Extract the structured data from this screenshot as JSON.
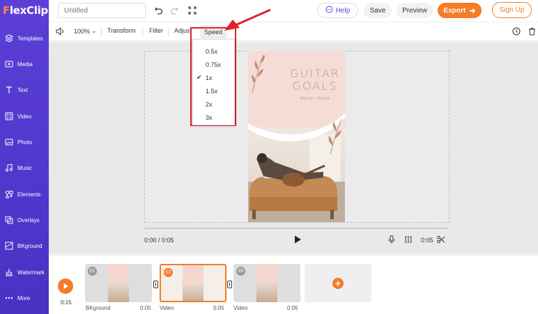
{
  "app": {
    "logo_text": "lexClip",
    "logo_letter": "F"
  },
  "sidebar": {
    "items": [
      {
        "label": "Templates",
        "icon": "templates-icon"
      },
      {
        "label": "Media",
        "icon": "media-icon"
      },
      {
        "label": "Text",
        "icon": "text-icon"
      },
      {
        "label": "Video",
        "icon": "video-icon"
      },
      {
        "label": "Photo",
        "icon": "photo-icon"
      },
      {
        "label": "Music",
        "icon": "music-icon"
      },
      {
        "label": "Elements",
        "icon": "elements-icon"
      },
      {
        "label": "Overlays",
        "icon": "overlays-icon"
      },
      {
        "label": "BKground",
        "icon": "background-icon"
      },
      {
        "label": "Watermark",
        "icon": "watermark-icon"
      },
      {
        "label": "More",
        "icon": "more-icon"
      }
    ]
  },
  "topbar": {
    "title_placeholder": "Untitled",
    "help_label": "Help",
    "save_label": "Save",
    "preview_label": "Preview",
    "export_label": "Export",
    "signup_label": "Sign Up"
  },
  "toolbar": {
    "zoom": "100%",
    "transform_label": "Transform",
    "filter_label": "Filter",
    "adjust_label": "Adjus",
    "speed_label": "Speed"
  },
  "speed_menu": {
    "options": [
      "0.5x",
      "0.75x",
      "1x",
      "1.5x",
      "2x",
      "3x"
    ],
    "selected": "1x"
  },
  "poster": {
    "title_line1": "GUITAR",
    "title_line2": "GOALS",
    "subtitle": "DELHI, INDIA"
  },
  "playback": {
    "current_time": "0:00 / 0:05",
    "duration": "0:05"
  },
  "timeline": {
    "total_time": "0:15",
    "clips": [
      {
        "num": "01",
        "label": "BKground",
        "duration": "0:05"
      },
      {
        "num": "02",
        "label": "Video",
        "duration": "0:05"
      },
      {
        "num": "03",
        "label": "Video",
        "duration": "0:05"
      }
    ]
  },
  "colors": {
    "sidebar": "#5b3fd6",
    "accent": "#f47c25",
    "highlight": "#e0202a"
  }
}
